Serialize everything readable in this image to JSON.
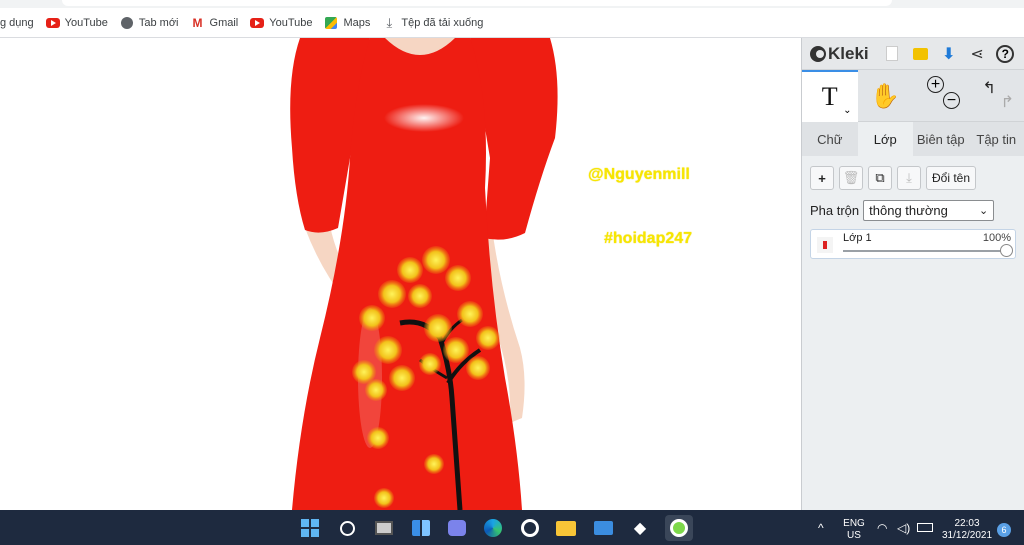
{
  "bookmarks": [
    {
      "label": "g dụng",
      "icon": "apps-icon"
    },
    {
      "label": "YouTube",
      "icon": "youtube-icon"
    },
    {
      "label": "Tab mới",
      "icon": "globe-icon"
    },
    {
      "label": "Gmail",
      "icon": "gmail-icon"
    },
    {
      "label": "YouTube",
      "icon": "youtube-icon"
    },
    {
      "label": "Maps",
      "icon": "maps-icon"
    },
    {
      "label": "Tệp đã tải xuống",
      "icon": "download-icon"
    }
  ],
  "canvas": {
    "watermark1": "@Nguyenmill",
    "watermark2": "#hoidap247"
  },
  "kleki": {
    "logo": "Kleki",
    "tool_text_glyph": "T",
    "tabs": [
      "Chữ",
      "Lớp",
      "Biên tập",
      "Tập tin"
    ],
    "active_tab": "Lớp",
    "rename_label": "Đổi tên",
    "blend_label": "Pha trộn",
    "blend_value": "thông thường",
    "layer": {
      "name": "Lớp 1",
      "opacity_text": "100%",
      "opacity": 1.0
    }
  },
  "taskbar": {
    "lang_top": "ENG",
    "lang_bottom": "US",
    "time": "22:03",
    "date": "31/12/2021",
    "notification_count": "6"
  },
  "colors": {
    "dress_red": "#ee1d12",
    "watermark_yellow": "#f7e600",
    "taskbar_bg": "#1e2a3f",
    "accent_blue": "#3a8ee6"
  }
}
